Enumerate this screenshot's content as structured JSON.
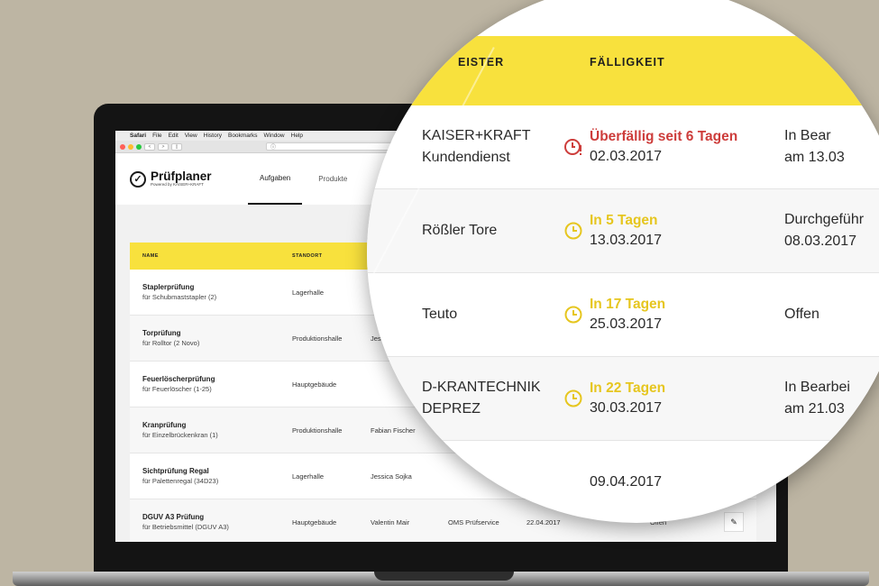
{
  "menubar": {
    "items": [
      "Safari",
      "File",
      "Edit",
      "View",
      "History",
      "Bookmarks",
      "Window",
      "Help"
    ]
  },
  "browser": {
    "back": "<",
    "forward": ">",
    "sidebar": "▯",
    "info": "ⓘ"
  },
  "app": {
    "logo_title": "Prüfplaner",
    "logo_subtitle": "Powered by KAISER+KRAFT",
    "nav": [
      "Aufgaben",
      "Produkte"
    ]
  },
  "table": {
    "headers": {
      "name": "NAME",
      "location": "STANDORT"
    },
    "rows": [
      {
        "title": "Staplerprüfung",
        "sub": "für Schubmaststapler (2)",
        "location": "Lagerhalle",
        "person": "F",
        "service": "",
        "date": "",
        "status": ""
      },
      {
        "title": "Torprüfung",
        "sub": "für Rolltor (2 Novo)",
        "location": "Produktionshalle",
        "person": "Jess",
        "service": "",
        "date": "",
        "status": ""
      },
      {
        "title": "Feuerlöscherprüfung",
        "sub": "für Feuerlöscher (1-25)",
        "location": "Hauptgebäude",
        "person": "",
        "service": "",
        "date": "",
        "status": ""
      },
      {
        "title": "Kranprüfung",
        "sub": "für Einzelbrückenkran (1)",
        "location": "Produktionshalle",
        "person": "Fabian Fischer",
        "service": "",
        "date": "",
        "status": ""
      },
      {
        "title": "Sichtprüfung Regal",
        "sub": "für Palettenregal (34D23)",
        "location": "Lagerhalle",
        "person": "Jessica Sojka",
        "service": "",
        "date": "",
        "status": ""
      },
      {
        "title": "DGUV A3 Prüfung",
        "sub": "für Betriebsmittel (DGUV A3)",
        "location": "Hauptgebäude",
        "person": "Valentin Mair",
        "service": "OMS Prüfservice",
        "date": "22.04.2017",
        "status": "Offen"
      }
    ]
  },
  "magnifier": {
    "headers": {
      "provider": "EISTER",
      "due": "FÄLLIGKEIT"
    },
    "rows": [
      {
        "provider_l1": "KAISER+KRAFT",
        "provider_l2": "Kundendienst",
        "due_label": "Überfällig seit 6 Tagen",
        "due_date": "02.03.2017",
        "status_l1": "In Bear",
        "status_l2": "am 13.03",
        "state": "overdue"
      },
      {
        "provider_l1": "Rößler Tore",
        "provider_l2": "",
        "due_label": "In 5 Tagen",
        "due_date": "13.03.2017",
        "status_l1": "Durchgeführ",
        "status_l2": "08.03.2017",
        "state": "soon"
      },
      {
        "provider_l1": "Teuto",
        "provider_l2": "",
        "due_label": "In 17 Tagen",
        "due_date": "25.03.2017",
        "status_l1": "Offen",
        "status_l2": "",
        "state": "soon"
      },
      {
        "provider_l1": "D-KRANTECHNIK",
        "provider_l2": "DEPREZ",
        "due_label": "In 22 Tagen",
        "due_date": "30.03.2017",
        "status_l1": "In Bearbei",
        "status_l2": "am 21.03",
        "state": "soon"
      },
      {
        "provider_l1": "",
        "provider_l2": "",
        "due_label": "",
        "due_date": "09.04.2017",
        "status_l1": "",
        "status_l2": "",
        "state": "none"
      }
    ]
  },
  "colors": {
    "brand_yellow": "#f8e13d",
    "overdue_red": "#cd3d3b",
    "soon_yellow": "#e6c61f",
    "background": "#bdb5a3"
  },
  "icons": {
    "overdue": "clock-alert-icon",
    "soon": "clock-icon",
    "edit": "pencil-icon",
    "logo": "check-circle-icon"
  }
}
